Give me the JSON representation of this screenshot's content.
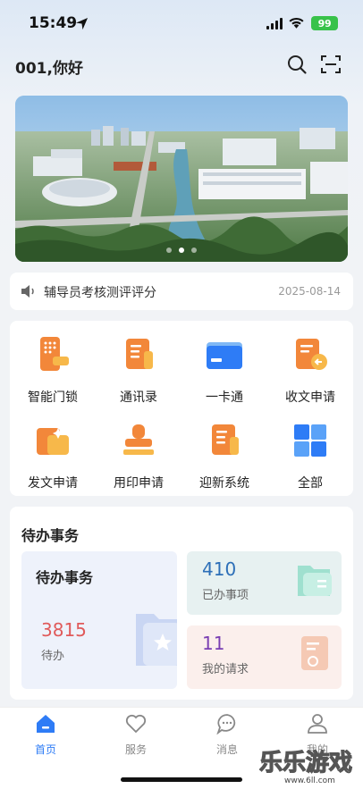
{
  "status_bar": {
    "time": "15:49",
    "battery": "99"
  },
  "header": {
    "greeting": "001,你好",
    "icons": [
      "search-icon",
      "scan-icon"
    ]
  },
  "banner": {
    "page_count": 3,
    "active_page": 2
  },
  "notice": {
    "title": "辅导员考核测评评分",
    "date": "2025-08-14"
  },
  "apps": [
    {
      "label": "智能门锁",
      "icon": "smart-lock-icon"
    },
    {
      "label": "通讯录",
      "icon": "contacts-icon"
    },
    {
      "label": "一卡通",
      "icon": "card-icon"
    },
    {
      "label": "收文申请",
      "icon": "receive-doc-icon"
    },
    {
      "label": "发文申请",
      "icon": "send-doc-icon"
    },
    {
      "label": "用印申请",
      "icon": "seal-icon"
    },
    {
      "label": "迎新系统",
      "icon": "welcome-system-icon"
    },
    {
      "label": "全部",
      "icon": "all-apps-icon"
    }
  ],
  "todo": {
    "section_title": "待办事务",
    "pending_card": {
      "title": "待办事务",
      "count": "3815",
      "label": "待办"
    },
    "done_card": {
      "count": "410",
      "label": "已办事项"
    },
    "request_card": {
      "count": "11",
      "label": "我的请求"
    }
  },
  "tabbar": [
    {
      "label": "首页",
      "icon": "home-icon",
      "active": true
    },
    {
      "label": "服务",
      "icon": "heart-icon",
      "active": false
    },
    {
      "label": "消息",
      "icon": "message-icon",
      "active": false
    },
    {
      "label": "我的",
      "icon": "user-icon",
      "active": false
    }
  ],
  "watermark": {
    "text": "乐乐游戏",
    "url": "www.6ll.com"
  },
  "colors": {
    "accent_blue": "#2e7cf6",
    "icon_orange": "#f2873a",
    "pending_red": "#e05a5a",
    "done_blue": "#2d6fb8",
    "request_purple": "#7a3fb3",
    "battery_green": "#38c24a"
  }
}
